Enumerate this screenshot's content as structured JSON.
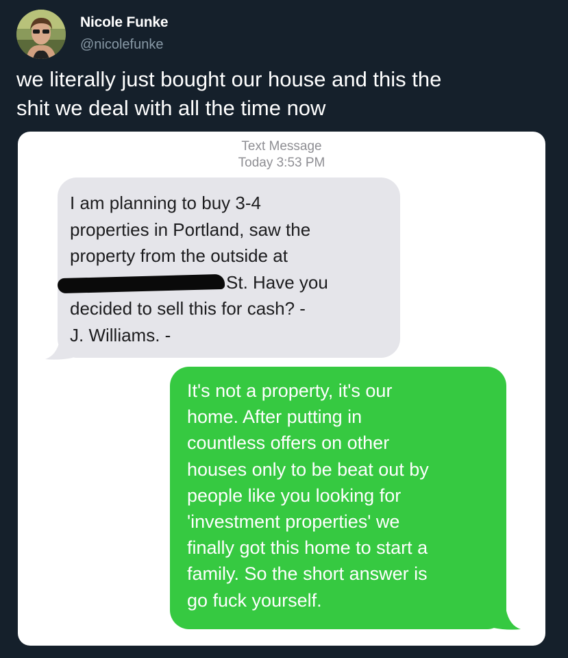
{
  "author": {
    "name": "Nicole Funke",
    "handle": "@nicolefunke"
  },
  "tweet": {
    "text_lines": [
      "we literally just bought our house and this the",
      "shit we deal with all the time now"
    ]
  },
  "screenshot": {
    "header_title": "Text Message",
    "header_time_day": "Today",
    "header_time": "3:53 PM",
    "incoming": {
      "lines": [
        "I am planning to buy 3-4",
        "properties in Portland, saw the",
        "property from the outside at",
        "St. Have you",
        "decided to sell this for cash?  -",
        "J. Williams. -"
      ]
    },
    "outgoing": {
      "lines": [
        "It's not a property, it's our",
        "home. After putting in",
        "countless offers on other",
        "houses only to be beat out by",
        "people like you looking for",
        "'investment properties' we",
        "finally got this home to start a",
        "family. So the short answer is",
        "go fuck yourself."
      ]
    }
  },
  "colors": {
    "background": "#15202b",
    "incoming_bubble": "#e5e5ea",
    "outgoing_bubble": "#36c941",
    "handle_text": "#8899a6"
  }
}
